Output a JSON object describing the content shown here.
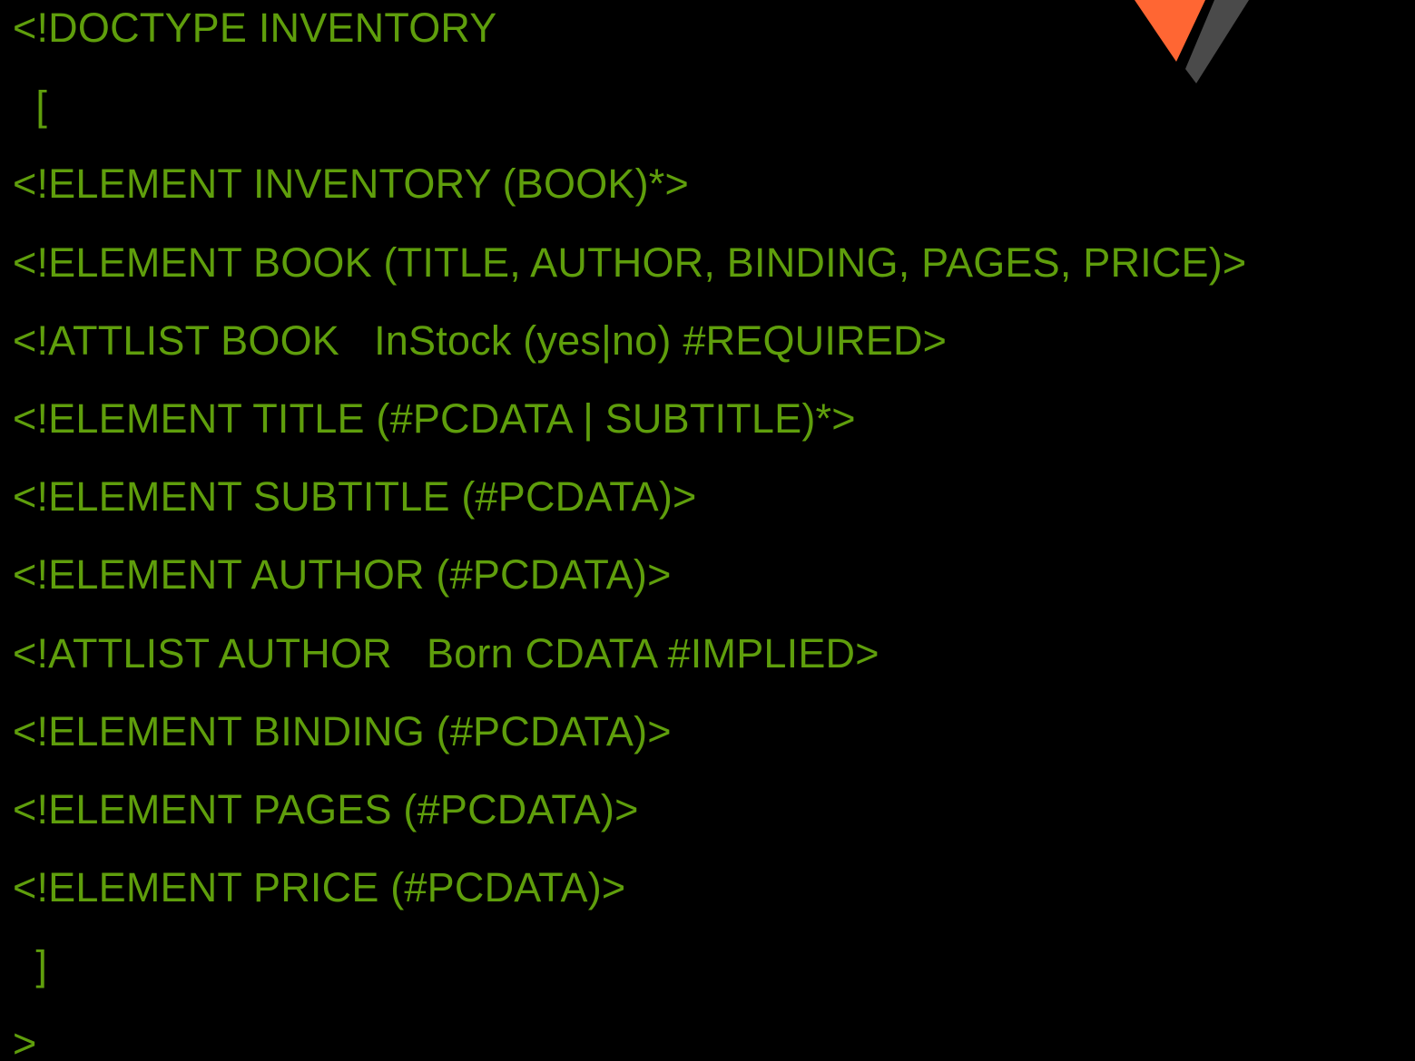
{
  "colors": {
    "background": "#000000",
    "code_text": "#5F9E0C",
    "logo_orange": "#FF6633",
    "logo_gray": "#4A4A4A"
  },
  "logo": {
    "icon": "chevron-logo-icon"
  },
  "code_lines": [
    "<!DOCTYPE INVENTORY",
    "  [",
    "<!ELEMENT INVENTORY (BOOK)*>",
    "<!ELEMENT BOOK (TITLE, AUTHOR, BINDING, PAGES, PRICE)>",
    "<!ATTLIST BOOK   InStock (yes|no) #REQUIRED>",
    "<!ELEMENT TITLE (#PCDATA | SUBTITLE)*>",
    "<!ELEMENT SUBTITLE (#PCDATA)>",
    "<!ELEMENT AUTHOR (#PCDATA)>",
    "<!ATTLIST AUTHOR   Born CDATA #IMPLIED>",
    "<!ELEMENT BINDING (#PCDATA)>",
    "<!ELEMENT PAGES (#PCDATA)>",
    "<!ELEMENT PRICE (#PCDATA)>",
    "  ]",
    ">"
  ]
}
